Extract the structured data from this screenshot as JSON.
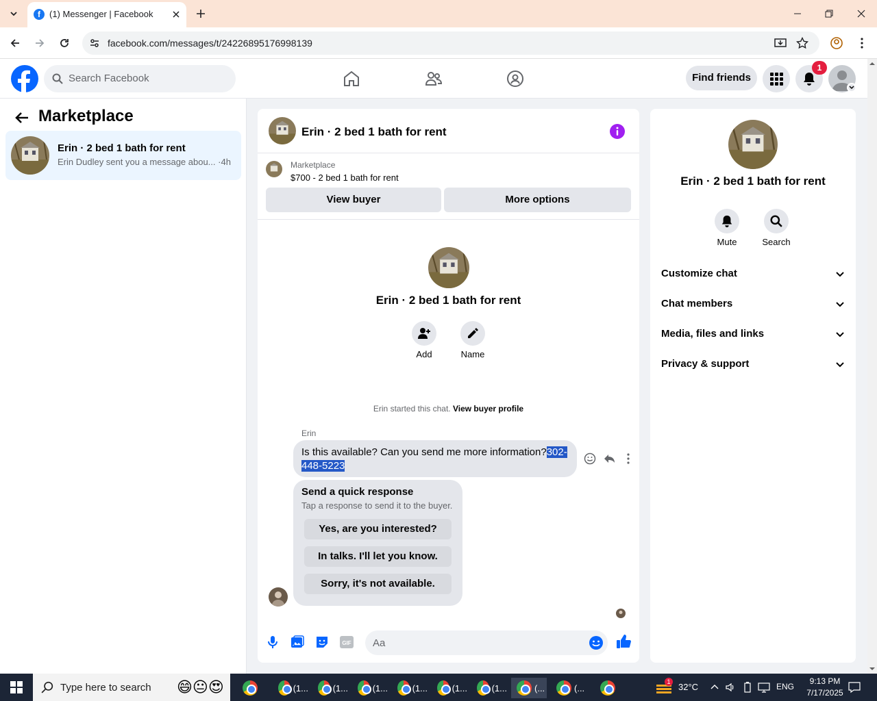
{
  "browser": {
    "tab_title": "(1) Messenger | Facebook",
    "url": "facebook.com/messages/t/24226895176998139"
  },
  "header": {
    "search_placeholder": "Search Facebook",
    "find_friends": "Find friends",
    "notification_count": "1"
  },
  "left": {
    "title": "Marketplace",
    "conversation": {
      "title": "Erin · 2 bed 1 bath for rent",
      "preview": "Erin Dudley sent you a message abou... ·4h"
    }
  },
  "chat": {
    "title": "Erin · 2 bed 1 bath for rent",
    "listing_source": "Marketplace",
    "listing_price": "$700 - 2 bed 1 bath for rent",
    "view_buyer": "View buyer",
    "more_options": "More options",
    "intro_title": "Erin · 2 bed 1 bath for rent",
    "add_label": "Add",
    "name_label": "Name",
    "started_text": "Erin started this chat.",
    "view_buyer_profile": "View buyer profile",
    "sender": "Erin",
    "message_text": "Is this available? Can you send me more information?",
    "message_phone_a": "302-",
    "message_phone_b": "448-5223",
    "quick_title": "Send a quick response",
    "quick_sub": "Tap a response to send it to the buyer.",
    "quick_replies": [
      "Yes, are you interested?",
      "In talks. I'll let you know.",
      "Sorry, it's not available."
    ],
    "composer_placeholder": "Aa"
  },
  "right": {
    "title": "Erin · 2 bed 1 bath for rent",
    "mute": "Mute",
    "search": "Search",
    "sections": [
      "Customize chat",
      "Chat members",
      "Media, files and links",
      "Privacy & support"
    ]
  },
  "taskbar": {
    "search_placeholder": "Type here to search",
    "app_label": "(1...",
    "app_label_short": "(...",
    "temperature": "32°C",
    "language": "ENG",
    "time": "9:13 PM",
    "date": "7/17/2025",
    "weather_badge": "1"
  },
  "colors": {
    "facebook_blue": "#0866ff",
    "highlight": "#2458c7",
    "notification_red": "#e41e3f",
    "info_purple": "#a020f0"
  }
}
